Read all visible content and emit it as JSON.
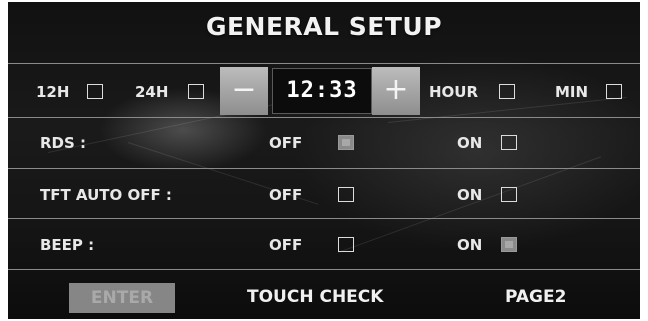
{
  "title": "GENERAL SETUP",
  "clock": {
    "format_12h_label": "12H",
    "format_12h_checked": false,
    "format_24h_label": "24H",
    "format_24h_checked": false,
    "minus_label": "−",
    "time_value": "12:33",
    "plus_label": "+",
    "hour_label": "HOUR",
    "hour_checked": false,
    "min_label": "MIN",
    "min_checked": false
  },
  "settings": [
    {
      "label": "RDS :",
      "off_label": "OFF",
      "off_checked": true,
      "on_label": "ON",
      "on_checked": false
    },
    {
      "label": "TFT AUTO OFF :",
      "off_label": "OFF",
      "off_checked": false,
      "on_label": "ON",
      "on_checked": false
    },
    {
      "label": "BEEP :",
      "off_label": "OFF",
      "off_checked": false,
      "on_label": "ON",
      "on_checked": true
    }
  ],
  "footer": {
    "enter_label": "ENTER",
    "touch_check_label": "TOUCH CHECK",
    "page2_label": "PAGE2"
  },
  "colors": {
    "background": "#141414",
    "text": "#e8e8e8",
    "accent_button": "#9e9e9e",
    "checked_box": "#8a8a8a",
    "divider": "#8a8a8a"
  }
}
